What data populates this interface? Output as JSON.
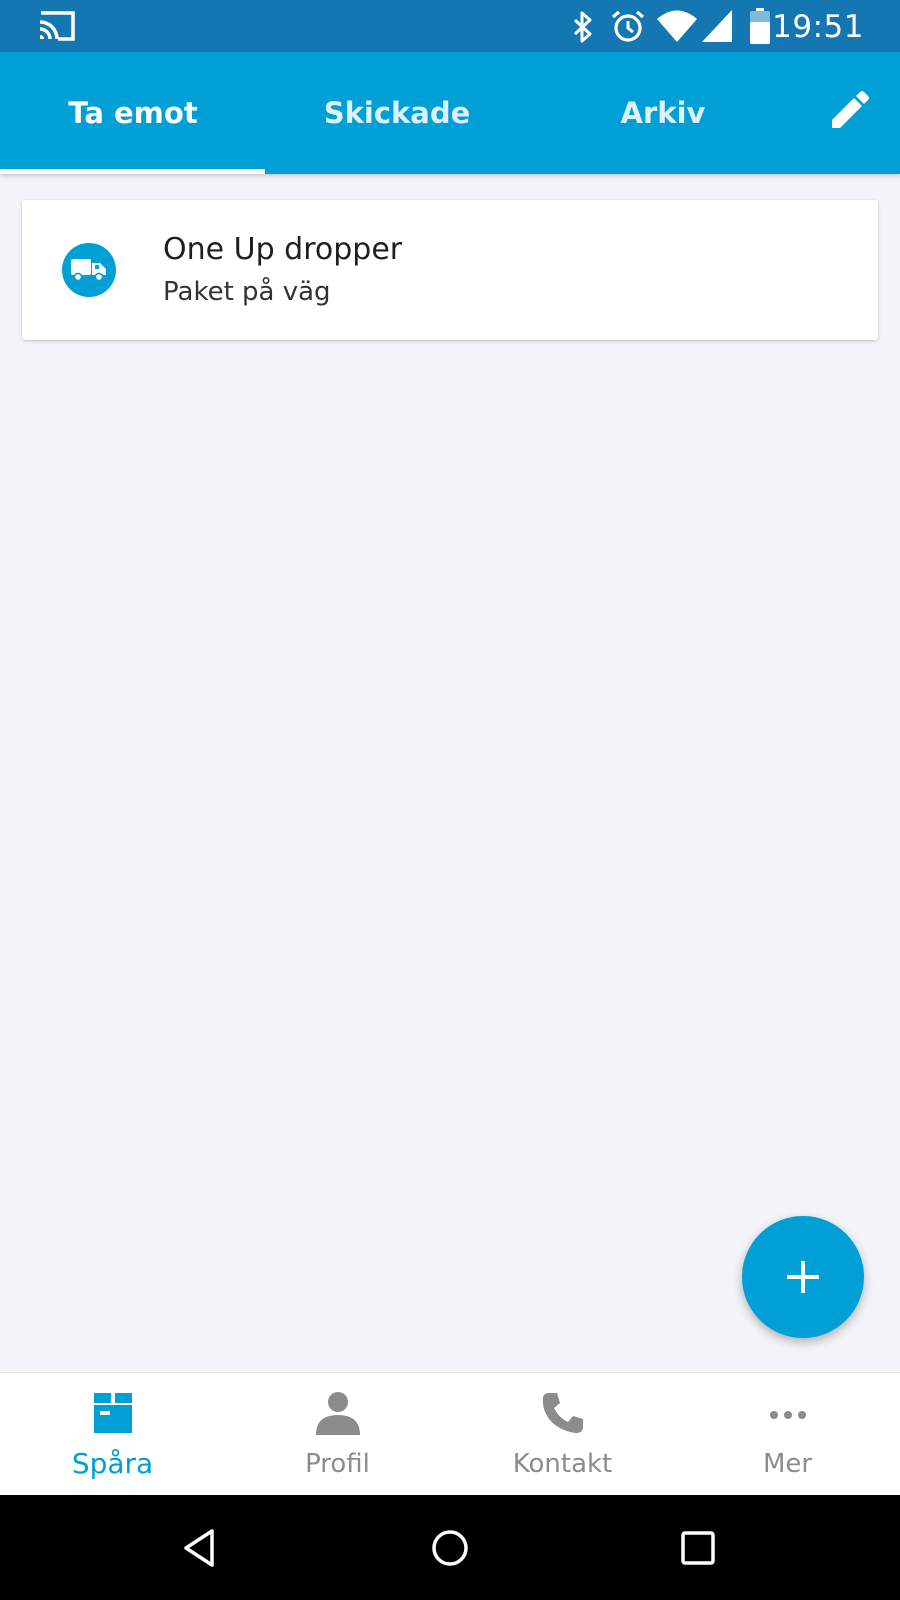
{
  "status_bar": {
    "time": "19:51",
    "icons": [
      "cast-icon",
      "bluetooth-icon",
      "alarm-icon",
      "wifi-icon",
      "signal-icon",
      "battery-icon"
    ]
  },
  "tabs": [
    {
      "label": "Ta emot",
      "active": true
    },
    {
      "label": "Skickade",
      "active": false
    },
    {
      "label": "Arkiv",
      "active": false
    }
  ],
  "toolbar": {
    "edit_icon": "pencil-icon"
  },
  "shipments": [
    {
      "title": "One Up dropper",
      "status": "Paket på väg",
      "icon": "truck-icon"
    }
  ],
  "fab": {
    "icon": "plus-icon"
  },
  "bottom_nav": [
    {
      "label": "Spåra",
      "icon": "package-icon",
      "active": true
    },
    {
      "label": "Profil",
      "icon": "person-icon",
      "active": false
    },
    {
      "label": "Kontakt",
      "icon": "phone-icon",
      "active": false
    },
    {
      "label": "Mer",
      "icon": "more-dots-icon",
      "active": false
    }
  ],
  "colors": {
    "status_bar": "#1577b1",
    "primary": "#00a0d6",
    "background": "#f3f4f9",
    "inactive_nav": "#8c8c8c"
  }
}
